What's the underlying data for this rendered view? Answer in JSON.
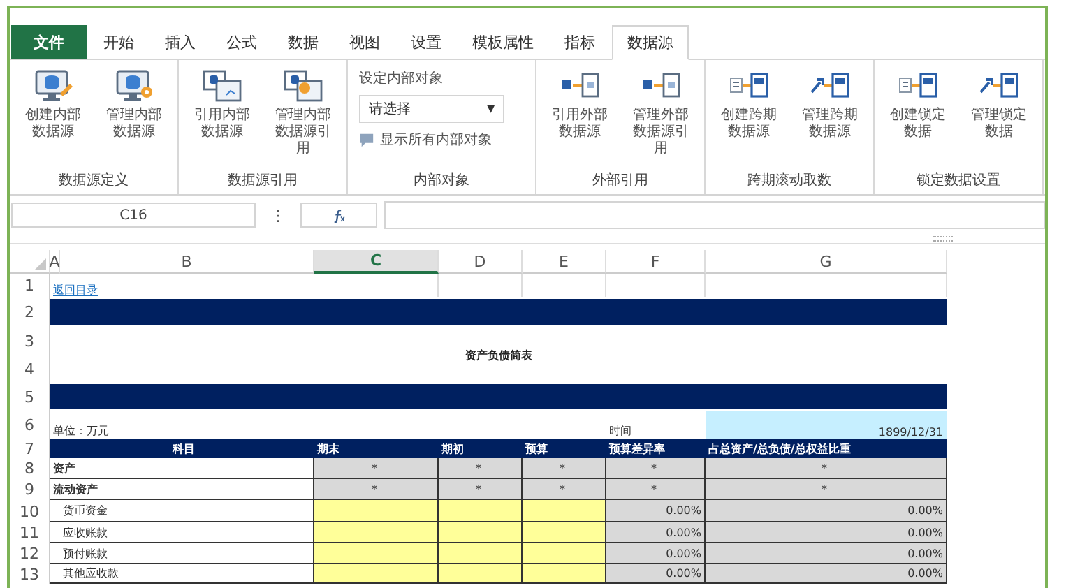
{
  "tabs": [
    {
      "label": "文件",
      "kind": "file",
      "selected": false
    },
    {
      "label": "开始",
      "kind": "tab",
      "selected": false
    },
    {
      "label": "插入",
      "kind": "tab",
      "selected": false
    },
    {
      "label": "公式",
      "kind": "tab",
      "selected": false
    },
    {
      "label": "数据",
      "kind": "tab",
      "selected": false
    },
    {
      "label": "视图",
      "kind": "tab",
      "selected": false
    },
    {
      "label": "设置",
      "kind": "tab",
      "selected": false
    },
    {
      "label": "模板属性",
      "kind": "tab",
      "selected": false
    },
    {
      "label": "指标",
      "kind": "tab",
      "selected": false
    },
    {
      "label": "数据源",
      "kind": "tab",
      "selected": true
    }
  ],
  "ribbon": [
    {
      "label": "数据源定义",
      "kind": "buttons",
      "buttons": [
        {
          "label": "创建内部数据源",
          "kind": "monitor-pencil"
        },
        {
          "label": "管理内部数据源",
          "kind": "monitor-gear"
        }
      ]
    },
    {
      "label": "数据源引用",
      "kind": "buttons",
      "buttons": [
        {
          "label": "引用内部数据源",
          "kind": "windows"
        },
        {
          "label": "管理内部数据源引用",
          "kind": "windows-gear"
        }
      ]
    },
    {
      "label": "内部对象",
      "kind": "object",
      "caption": "设定内部对象",
      "select": "请选择",
      "caret": "▼",
      "toggle": "显示所有内部对象"
    },
    {
      "label": "外部引用",
      "kind": "buttons",
      "buttons": [
        {
          "label": "引用外部数据源",
          "kind": "db-doc"
        },
        {
          "label": "管理外部数据源引用",
          "kind": "db-doc"
        }
      ]
    },
    {
      "label": "跨期滚动取数",
      "kind": "buttons",
      "buttons": [
        {
          "label": "创建跨期数据源",
          "kind": "list-doc"
        },
        {
          "label": "管理跨期数据源",
          "kind": "wrench-doc"
        }
      ]
    },
    {
      "label": "锁定数据设置",
      "kind": "buttons",
      "buttons": [
        {
          "label": "创建锁定数据",
          "kind": "list-doc"
        },
        {
          "label": "管理锁定数据",
          "kind": "wrench-doc"
        }
      ]
    }
  ],
  "formula_bar": {
    "name_box": "C16",
    "menu": "⋮"
  },
  "sheet": {
    "column_letters": [
      {
        "label": "A",
        "selected": false
      },
      {
        "label": "B",
        "selected": false
      },
      {
        "label": "C",
        "selected": true
      },
      {
        "label": "D",
        "selected": false
      },
      {
        "label": "E",
        "selected": false
      },
      {
        "label": "F",
        "selected": false
      },
      {
        "label": "G",
        "selected": false
      }
    ],
    "row_numbers": [
      "1",
      "2",
      "3",
      "4",
      "5",
      "6",
      "7",
      "8",
      "9",
      "10",
      "11",
      "12",
      "13"
    ],
    "link": "返回目录",
    "title": "资产负债简表",
    "unit": "单位：万元",
    "time_label": "时间",
    "time_value": "1899/12/31",
    "table": {
      "header": [
        "科目",
        "期末",
        "期初",
        "预算",
        "预算差异率",
        "占总资产/总负债/总权益比重"
      ],
      "rows": [
        {
          "label": "资产",
          "kind": "section",
          "cells": [
            {
              "value": "*",
              "kind": "calc"
            },
            {
              "value": "*",
              "kind": "calc"
            },
            {
              "value": "*",
              "kind": "calc"
            },
            {
              "value": "*",
              "kind": "calc"
            },
            {
              "value": "*",
              "kind": "calc"
            }
          ]
        },
        {
          "label": "流动资产",
          "kind": "section",
          "cells": [
            {
              "value": "*",
              "kind": "calc"
            },
            {
              "value": "*",
              "kind": "calc"
            },
            {
              "value": "*",
              "kind": "calc"
            },
            {
              "value": "*",
              "kind": "calc"
            },
            {
              "value": "*",
              "kind": "calc"
            }
          ]
        },
        {
          "label": "货币资金",
          "kind": "item",
          "cells": [
            {
              "kind": "input"
            },
            {
              "kind": "input"
            },
            {
              "kind": "input"
            },
            {
              "value": "0.00%",
              "kind": "calc"
            },
            {
              "value": "0.00%",
              "kind": "calc"
            }
          ]
        },
        {
          "label": "应收账款",
          "kind": "item",
          "cells": [
            {
              "kind": "input"
            },
            {
              "kind": "input"
            },
            {
              "kind": "input"
            },
            {
              "value": "0.00%",
              "kind": "calc"
            },
            {
              "value": "0.00%",
              "kind": "calc"
            }
          ]
        },
        {
          "label": "预付账款",
          "kind": "item",
          "cells": [
            {
              "kind": "input"
            },
            {
              "kind": "input"
            },
            {
              "kind": "input"
            },
            {
              "value": "0.00%",
              "kind": "calc"
            },
            {
              "value": "0.00%",
              "kind": "calc"
            }
          ]
        },
        {
          "label": "其他应收款",
          "kind": "item",
          "cells": [
            {
              "kind": "input"
            },
            {
              "kind": "input"
            },
            {
              "kind": "input"
            },
            {
              "value": "0.00%",
              "kind": "calc"
            },
            {
              "value": "0.00%",
              "kind": "calc"
            }
          ]
        }
      ]
    }
  }
}
